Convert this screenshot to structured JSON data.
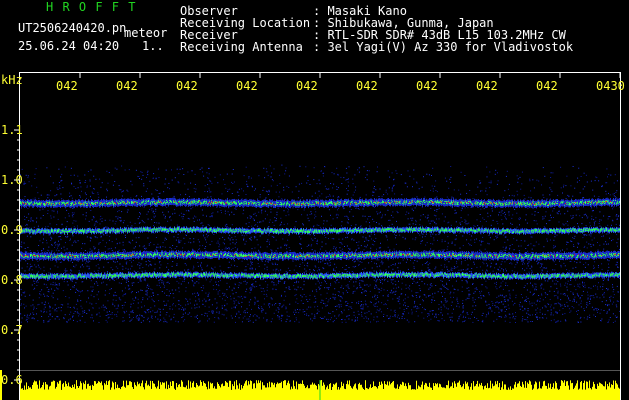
{
  "app": {
    "logo": "H R O F F T",
    "filename": "UT2506240420.pn",
    "mode": "meteor",
    "datetime": "25.06.24 04:20",
    "page_indicator": "1.."
  },
  "info": {
    "labels": [
      "Observer",
      "Receiving Location",
      "Receiver",
      "Receiving Antenna"
    ],
    "values": [
      ": Masaki Kano",
      ": Shibukawa, Gunma, Japan",
      ": RTL-SDR SDR# 43dB L15 103.2MHz CW",
      ": 3el Yagi(V) Az 330 for Vladivostok"
    ]
  },
  "y_axis": {
    "unit": "kHz",
    "ticks": [
      "1.1",
      "1.0",
      "0.9",
      "0.8",
      "0.7",
      "0.6"
    ]
  },
  "x_axis": {
    "ticks": [
      "042",
      "042",
      "042",
      "042",
      "042",
      "042",
      "042",
      "042",
      "042",
      "0430"
    ]
  },
  "spectrogram": {
    "freq_range_khz": [
      0.6,
      1.15
    ],
    "bright_lines_khz": [
      0.955,
      0.85
    ],
    "faint_lines_khz": [
      0.9,
      0.81
    ],
    "noise_band_khz": [
      0.76,
      0.995
    ]
  },
  "colors": {
    "text_white": "#ffffff",
    "text_green": "#21d421",
    "text_yellow": "#ffff33",
    "noise_blue": "#1a2fd6",
    "signal_green": "#33ff66",
    "signal_red": "#ff2a1a",
    "power_yellow": "#ffff00"
  }
}
